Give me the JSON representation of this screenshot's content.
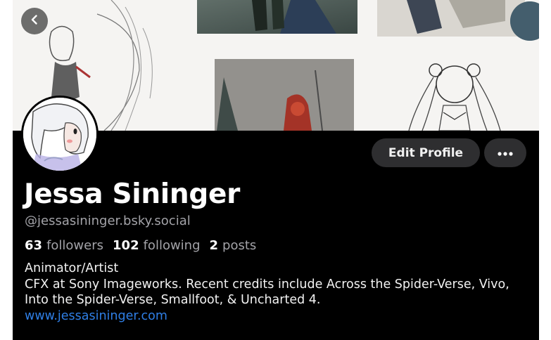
{
  "profile": {
    "display_name": "Jessa Sininger",
    "handle": "@jessasininger.bsky.social",
    "stats": {
      "followers_count": "63",
      "followers_label": "followers",
      "following_count": "102",
      "following_label": "following",
      "posts_count": "2",
      "posts_label": "posts"
    },
    "bio": {
      "line1": "Animator/Artist",
      "line2": "CFX at Sony Imageworks. Recent credits include Across the Spider-Verse, Vivo, Into the Spider-Verse, Smallfoot, & Uncharted 4.",
      "link": "www.jessasininger.com"
    }
  },
  "actions": {
    "edit_profile_label": "Edit Profile"
  },
  "icons": {
    "back": "chevron-left-icon",
    "more": "ellipsis-horizontal-icon"
  },
  "colors": {
    "background": "#000000",
    "button_bg": "#2e2e30",
    "secondary_text": "#a3a3a8",
    "link": "#2f7fe6"
  }
}
